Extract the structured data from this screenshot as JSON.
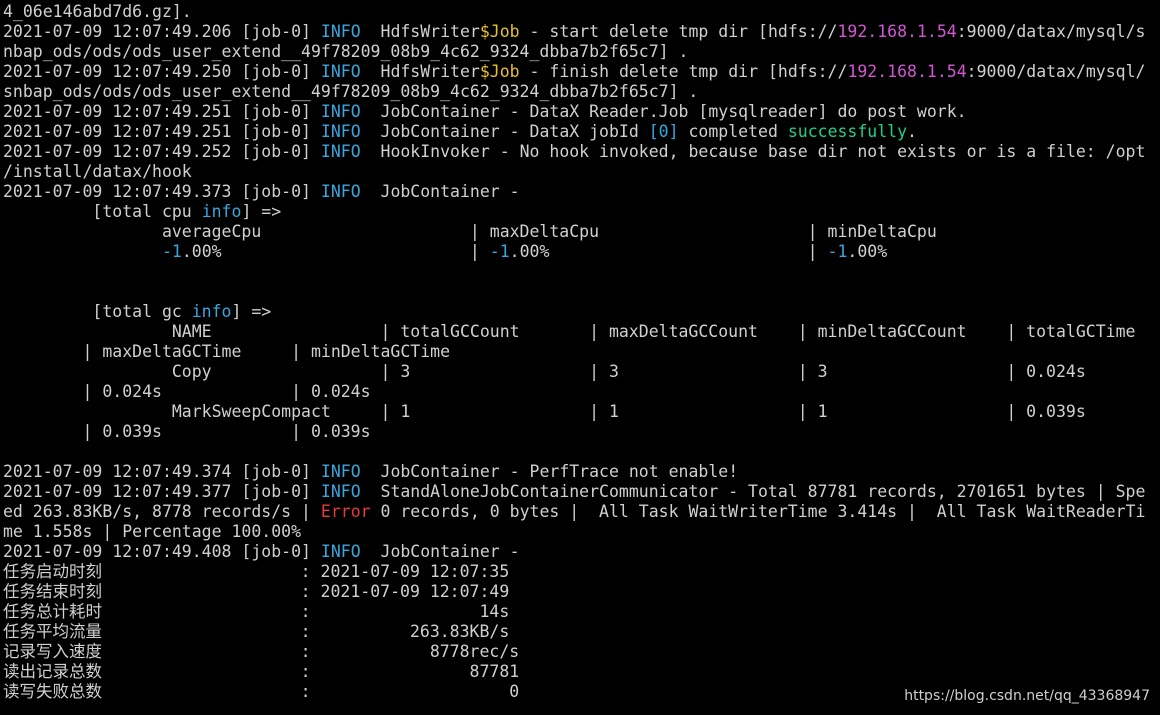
{
  "colors": {
    "background": "#000000",
    "default_text": "#d0d0d0",
    "info": "#3aa6e0",
    "variable": "#e8c12c",
    "ip_address": "#d455d4",
    "success": "#1fd18a",
    "error": "#e83b3b"
  },
  "terminal": {
    "lines": [
      [
        [
          "default",
          "4_06e146abd7d6.gz]."
        ]
      ],
      [
        [
          "default",
          "2021-07-09 12:07:49.206 [job-0] "
        ],
        [
          "info",
          "INFO"
        ],
        [
          "default",
          "  HdfsWriter"
        ],
        [
          "var",
          "$Job"
        ],
        [
          "default",
          " - start delete tmp dir [hdfs://"
        ],
        [
          "ip",
          "192.168.1.54"
        ],
        [
          "default",
          ":9000/datax/mysql/s"
        ]
      ],
      [
        [
          "default",
          "nbap_ods/ods/ods_user_extend__49f78209_08b9_4c62_9324_dbba7b2f65c7] ."
        ]
      ],
      [
        [
          "default",
          "2021-07-09 12:07:49.250 [job-0] "
        ],
        [
          "info",
          "INFO"
        ],
        [
          "default",
          "  HdfsWriter"
        ],
        [
          "var",
          "$Job"
        ],
        [
          "default",
          " - finish delete tmp dir [hdfs://"
        ],
        [
          "ip",
          "192.168.1.54"
        ],
        [
          "default",
          ":9000/datax/mysql/"
        ]
      ],
      [
        [
          "default",
          "snbap_ods/ods/ods_user_extend__49f78209_08b9_4c62_9324_dbba7b2f65c7] ."
        ]
      ],
      [
        [
          "default",
          "2021-07-09 12:07:49.251 [job-0] "
        ],
        [
          "info",
          "INFO"
        ],
        [
          "default",
          "  JobContainer - DataX Reader.Job [mysqlreader] do post work."
        ]
      ],
      [
        [
          "default",
          "2021-07-09 12:07:49.251 [job-0] "
        ],
        [
          "info",
          "INFO"
        ],
        [
          "default",
          "  JobContainer - DataX jobId "
        ],
        [
          "num",
          "[0]"
        ],
        [
          "default",
          " completed "
        ],
        [
          "ok",
          "successfully"
        ],
        [
          "default",
          "."
        ]
      ],
      [
        [
          "default",
          "2021-07-09 12:07:49.252 [job-0] "
        ],
        [
          "info",
          "INFO"
        ],
        [
          "default",
          "  HookInvoker - No hook invoked, because base dir not exists or is a file: /opt"
        ]
      ],
      [
        [
          "default",
          "/install/datax/hook"
        ]
      ],
      [
        [
          "default",
          "2021-07-09 12:07:49.373 [job-0] "
        ],
        [
          "info",
          "INFO"
        ],
        [
          "default",
          "  JobContainer -"
        ]
      ],
      [
        [
          "default",
          "         [total cpu "
        ],
        [
          "info",
          "info"
        ],
        [
          "default",
          "] =>"
        ]
      ],
      [
        [
          "default",
          "                averageCpu                     | maxDeltaCpu                     | minDeltaCpu"
        ]
      ],
      [
        [
          "default",
          "                "
        ],
        [
          "num",
          "-1"
        ],
        [
          "default",
          ".00%                         | "
        ],
        [
          "num",
          "-1"
        ],
        [
          "default",
          ".00%                          | "
        ],
        [
          "num",
          "-1"
        ],
        [
          "default",
          ".00%"
        ]
      ],
      [
        [
          "default",
          " "
        ]
      ],
      [
        [
          "default",
          " "
        ]
      ],
      [
        [
          "default",
          "         [total gc "
        ],
        [
          "info",
          "info"
        ],
        [
          "default",
          "] =>"
        ]
      ],
      [
        [
          "default",
          "                 NAME                 | totalGCCount       | maxDeltaGCCount    | minDeltaGCCount    | totalGCTime"
        ]
      ],
      [
        [
          "default",
          "        | maxDeltaGCTime     | minDeltaGCTime"
        ]
      ],
      [
        [
          "default",
          "                 Copy                 | 3                  | 3                  | 3                  | 0.024s"
        ]
      ],
      [
        [
          "default",
          "        | 0.024s             | 0.024s"
        ]
      ],
      [
        [
          "default",
          "                 MarkSweepCompact     | 1                  | 1                  | 1                  | 0.039s"
        ]
      ],
      [
        [
          "default",
          "        | 0.039s             | 0.039s"
        ]
      ],
      [
        [
          "default",
          " "
        ]
      ],
      [
        [
          "default",
          "2021-07-09 12:07:49.374 [job-0] "
        ],
        [
          "info",
          "INFO"
        ],
        [
          "default",
          "  JobContainer - PerfTrace not enable!"
        ]
      ],
      [
        [
          "default",
          "2021-07-09 12:07:49.377 [job-0] "
        ],
        [
          "info",
          "INFO"
        ],
        [
          "default",
          "  StandAloneJobContainerCommunicator - Total 87781 records, 2701651 bytes | Spe"
        ]
      ],
      [
        [
          "default",
          "ed 263.83KB/s, 8778 records/s | "
        ],
        [
          "error",
          "Error"
        ],
        [
          "default",
          " 0 records, 0 bytes |  All Task WaitWriterTime 3.414s |  All Task WaitReaderTi"
        ]
      ],
      [
        [
          "default",
          "me 1.558s | Percentage 100.00%"
        ]
      ],
      [
        [
          "default",
          "2021-07-09 12:07:49.408 [job-0] "
        ],
        [
          "info",
          "INFO"
        ],
        [
          "default",
          "  JobContainer -"
        ]
      ],
      [
        [
          "default",
          "任务启动时刻                    : 2021-07-09 12:07:35"
        ]
      ],
      [
        [
          "default",
          "任务结束时刻                    : 2021-07-09 12:07:49"
        ]
      ],
      [
        [
          "default",
          "任务总计耗时                    :                 14s"
        ]
      ],
      [
        [
          "default",
          "任务平均流量                    :          263.83KB/s"
        ]
      ],
      [
        [
          "default",
          "记录写入速度                    :            8778rec/s"
        ]
      ],
      [
        [
          "default",
          "读出记录总数                    :                87781"
        ]
      ],
      [
        [
          "default",
          "读写失败总数                    :                    0"
        ]
      ]
    ]
  },
  "watermark": "https://blog.csdn.net/qq_43368947"
}
